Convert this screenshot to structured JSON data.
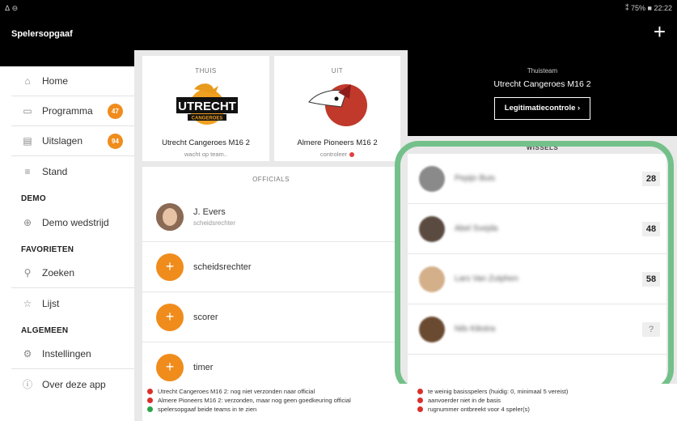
{
  "status": {
    "left": "ᐃ ⊖",
    "right": "⁑ 75% ■ 22:22"
  },
  "app": {
    "title": "Spelersopgaaf",
    "add_label": "+"
  },
  "sidebar": {
    "items": [
      {
        "label": "Home",
        "icon": "home-icon"
      },
      {
        "label": "Programma",
        "icon": "calendar-icon",
        "badge": "47"
      },
      {
        "label": "Uitslagen",
        "icon": "results-icon",
        "badge": "94"
      },
      {
        "label": "Stand",
        "icon": "list-icon"
      }
    ],
    "section_demo": "DEMO",
    "demo_item": "Demo wedstrijd",
    "section_favorites": "FAVORIETEN",
    "favorites": [
      {
        "label": "Zoeken",
        "icon": "search-icon"
      },
      {
        "label": "Lijst",
        "icon": "star-icon"
      }
    ],
    "section_general": "ALGEMEEN",
    "general": [
      {
        "label": "Instellingen",
        "icon": "gear-icon"
      },
      {
        "label": "Over deze app",
        "icon": "info-icon"
      }
    ]
  },
  "home_team": {
    "label": "THUIS",
    "name": "Utrecht Cangeroes M16 2",
    "status": "wacht op team..",
    "logo_text": "UTRECHT",
    "logo_sub": "CANGEROES"
  },
  "away_team": {
    "label": "UIT",
    "name": "Almere Pioneers M16 2",
    "status": "controleer"
  },
  "home_panel": {
    "label": "Thuisteam",
    "team": "Utrecht Cangeroes M16 2",
    "button": "Legitimatiecontrole  ›"
  },
  "officials": {
    "header": "OFFICIALS",
    "assigned": {
      "name": "J. Evers",
      "role": "scheidsrechter"
    },
    "open": [
      "scheidsrechter",
      "scorer",
      "timer"
    ]
  },
  "wissels": {
    "header": "WISSELS",
    "players": [
      {
        "name": "Pepijn Buis",
        "number": "28"
      },
      {
        "name": "Abel Svejda",
        "number": "48"
      },
      {
        "name": "Lars Van Zutphen",
        "number": "58"
      },
      {
        "name": "Nils Kikstra",
        "number": "?"
      }
    ]
  },
  "footer_left": [
    {
      "text": "Utrecht Cangeroes M16 2: nog niet verzonden naar official",
      "color": "#d9302b"
    },
    {
      "text": "Almere Pioneers M16 2: verzonden, maar nog geen goedkeuring official",
      "color": "#d9302b"
    },
    {
      "text": "spelersopgaaf beide teams in te zien",
      "color": "#2aa44a"
    }
  ],
  "footer_right": [
    {
      "text": "te weinig basisspelers (huidig: 0, minimaal 5 vereist)",
      "color": "#d9302b"
    },
    {
      "text": "aanvoerder niet in de basis",
      "color": "#d9302b"
    },
    {
      "text": "rugnummer ontbreekt voor 4 speler(s)",
      "color": "#d9302b"
    }
  ],
  "colors": {
    "accent": "#f08c1c",
    "highlight": "#74c08a"
  }
}
